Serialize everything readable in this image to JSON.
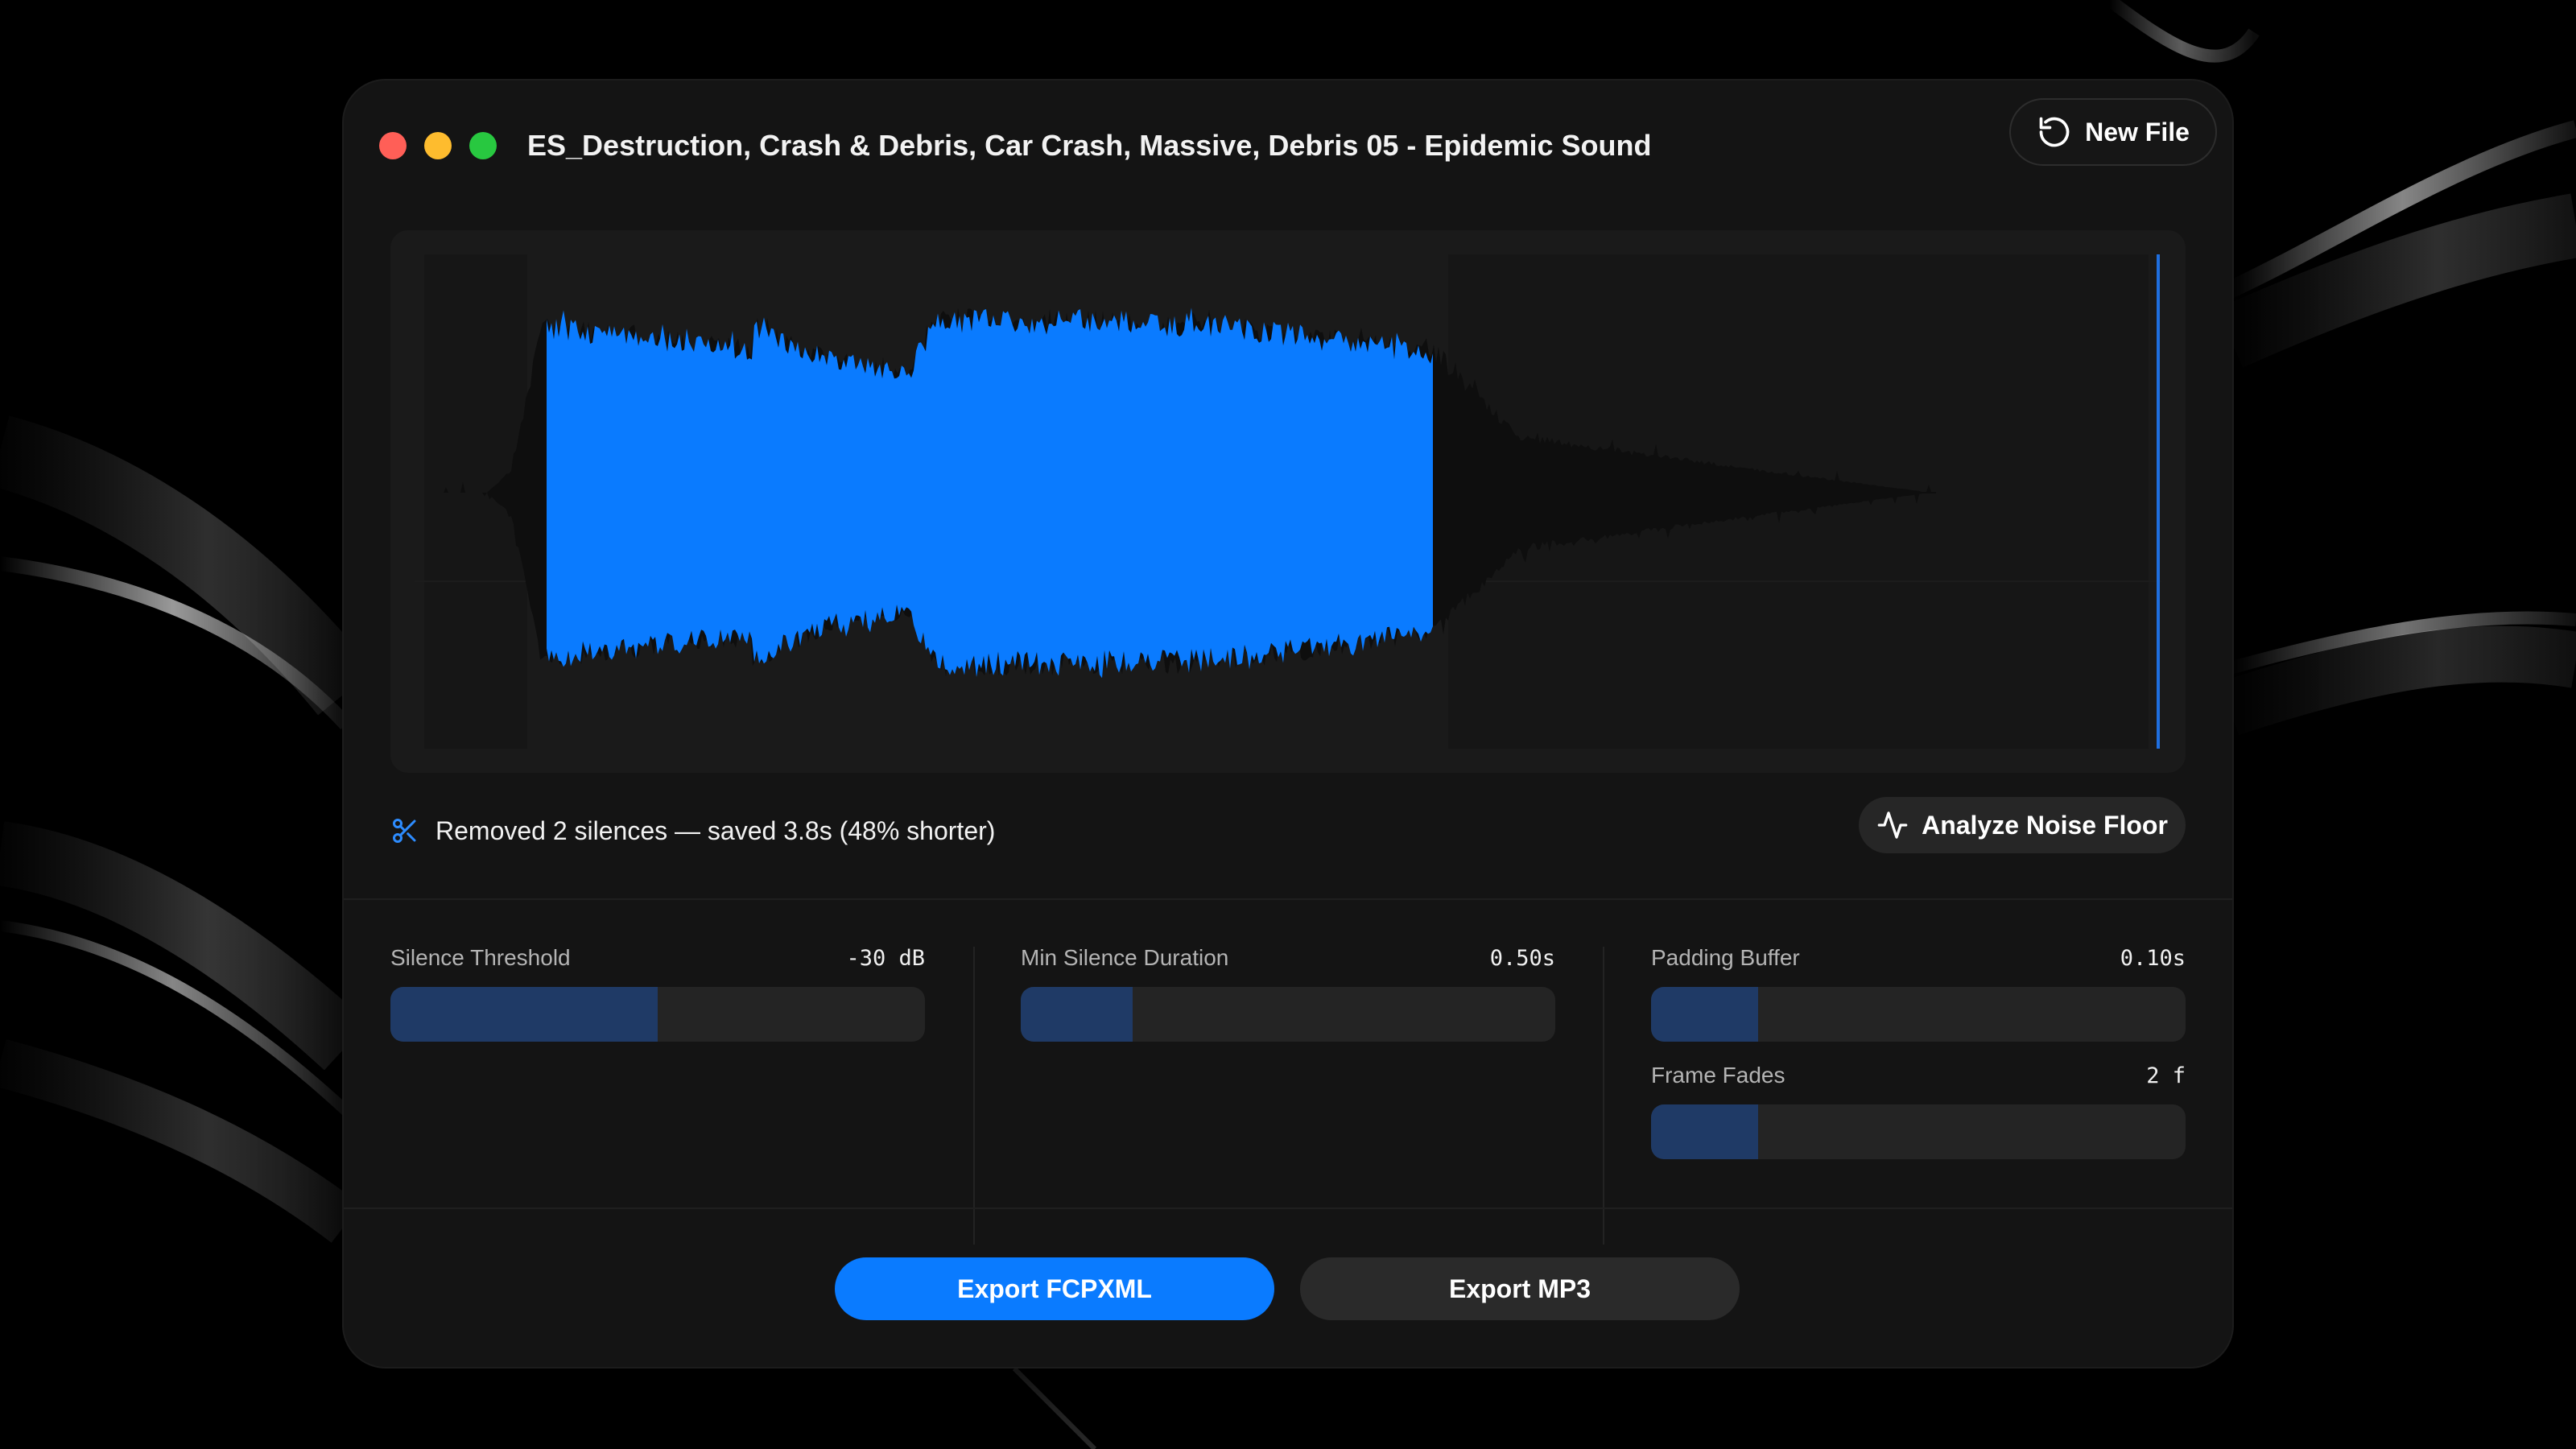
{
  "window": {
    "title": "ES_Destruction, Crash & Debris, Car Crash, Massive, Debris 05 - Epidemic Sound",
    "traffic_lights": [
      "close",
      "minimize",
      "zoom"
    ],
    "new_file_label": "New File",
    "new_file_icon": "rotate-ccw-icon"
  },
  "waveform": {
    "active_color": "#0a7bff",
    "inactive_color": "#0e0e0e",
    "playhead_color": "#1f6fe0"
  },
  "status": {
    "icon": "scissors-icon",
    "text": "Removed 2 silences — saved 3.8s (48% shorter)",
    "analyze_label": "Analyze Noise Floor",
    "analyze_icon": "activity-icon"
  },
  "controls": {
    "silence_threshold": {
      "label": "Silence Threshold",
      "value": "-30 dB",
      "level": 0.5
    },
    "min_silence_duration": {
      "label": "Min Silence Duration",
      "value": "0.50s",
      "level": 0.21
    },
    "padding_buffer": {
      "label": "Padding Buffer",
      "value": "0.10s",
      "level": 0.2
    },
    "frame_fades": {
      "label": "Frame Fades",
      "value": "2 f",
      "level": 0.2
    }
  },
  "actions": {
    "export_fcpxml": "Export FCPXML",
    "export_mp3": "Export MP3"
  },
  "colors": {
    "accent": "#0a7bff",
    "slider_fill": "#1f3a66",
    "window_bg": "#141414"
  }
}
